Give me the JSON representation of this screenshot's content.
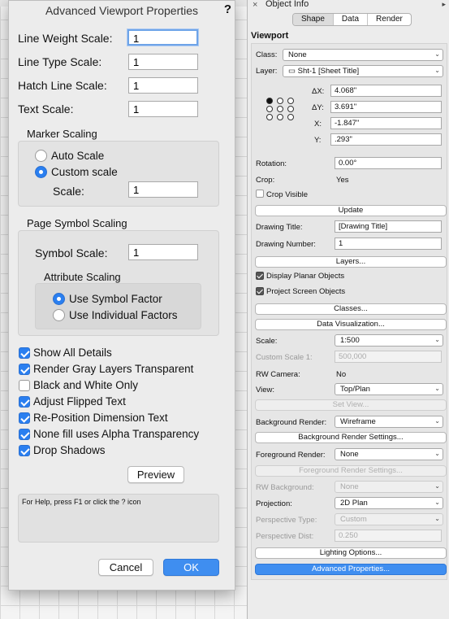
{
  "dialog": {
    "title": "Advanced Viewport Properties",
    "help_glyph": "?",
    "line_weight_scale_label": "Line Weight Scale:",
    "line_weight_scale_value": "1",
    "line_type_scale_label": "Line Type Scale:",
    "line_type_scale_value": "1",
    "hatch_line_scale_label": "Hatch Line Scale:",
    "hatch_line_scale_value": "1",
    "text_scale_label": "Text Scale:",
    "text_scale_value": "1",
    "marker_scaling_title": "Marker Scaling",
    "auto_scale_label": "Auto Scale",
    "custom_scale_label": "Custom scale",
    "marker_scale_label": "Scale:",
    "marker_scale_value": "1",
    "page_symbol_scaling_title": "Page Symbol Scaling",
    "symbol_scale_label": "Symbol Scale:",
    "symbol_scale_value": "1",
    "attribute_scaling_title": "Attribute Scaling",
    "use_symbol_factor_label": "Use Symbol Factor",
    "use_individual_factors_label": "Use Individual Factors",
    "checkboxes": [
      {
        "label": "Show All Details",
        "checked": true
      },
      {
        "label": "Render Gray Layers Transparent",
        "checked": true
      },
      {
        "label": "Black and White Only",
        "checked": false
      },
      {
        "label": "Adjust Flipped Text",
        "checked": true
      },
      {
        "label": "Re-Position Dimension Text",
        "checked": true
      },
      {
        "label": "None fill uses Alpha Transparency",
        "checked": true
      },
      {
        "label": "Drop Shadows",
        "checked": true
      }
    ],
    "preview_label": "Preview",
    "help_text": "For Help, press F1 or click the ? icon",
    "cancel_label": "Cancel",
    "ok_label": "OK",
    "accent_color": "#3f8ef0"
  },
  "oip": {
    "title": "Object Info",
    "close_glyph": "×",
    "tabs": [
      "Shape",
      "Data",
      "Render"
    ],
    "selected_tab": "Shape",
    "section": "Viewport",
    "class_label": "Class:",
    "class_value": "None",
    "layer_label": "Layer:",
    "layer_value": "Sht-1 [Sheet Title]",
    "dx_label": "ΔX:",
    "dx_value": "4.068\"",
    "dy_label": "ΔY:",
    "dy_value": "3.691\"",
    "x_label": "X:",
    "x_value": "-1.847\"",
    "y_label": "Y:",
    "y_value": ".293\"",
    "rotation_label": "Rotation:",
    "rotation_value": "0.00°",
    "crop_label": "Crop:",
    "crop_value": "Yes",
    "crop_visible_label": "Crop Visible",
    "update_label": "Update",
    "drawing_title_label": "Drawing Title:",
    "drawing_title_value": "[Drawing Title]",
    "drawing_number_label": "Drawing Number:",
    "drawing_number_value": "1",
    "layers_label": "Layers...",
    "display_planar_label": "Display Planar Objects",
    "project_screen_label": "Project Screen Objects",
    "classes_label": "Classes...",
    "data_viz_label": "Data Visualization...",
    "scale_label": "Scale:",
    "scale_value": "1:500",
    "custom_scale_label": "Custom Scale 1:",
    "custom_scale_value": "500,000",
    "rw_camera_label": "RW Camera:",
    "rw_camera_value": "No",
    "view_label": "View:",
    "view_value": "Top/Plan",
    "set_view_label": "Set View...",
    "bg_render_label": "Background Render:",
    "bg_render_value": "Wireframe",
    "bg_render_settings_label": "Background Render Settings...",
    "fg_render_label": "Foreground Render:",
    "fg_render_value": "None",
    "fg_render_settings_label": "Foreground Render Settings...",
    "rw_background_label": "RW Background:",
    "rw_background_value": "None",
    "projection_label": "Projection:",
    "projection_value": "2D Plan",
    "perspective_type_label": "Perspective Type:",
    "perspective_type_value": "Custom",
    "perspective_dist_label": "Perspective Dist:",
    "perspective_dist_value": "0.250",
    "lighting_label": "Lighting Options...",
    "advanced_label": "Advanced Properties..."
  }
}
